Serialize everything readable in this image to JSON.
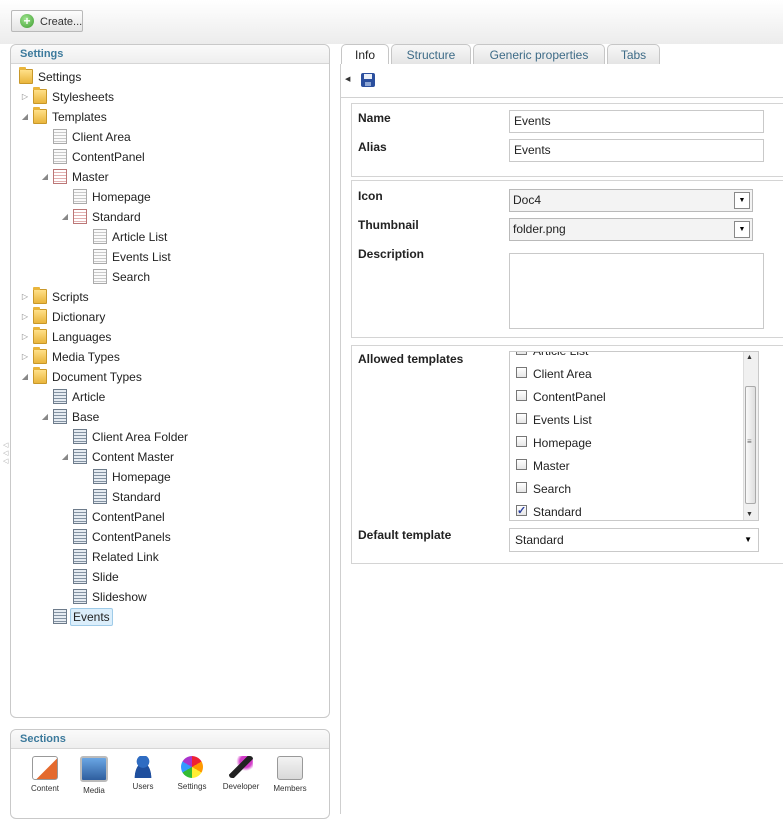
{
  "toolbar": {
    "create_label": "Create..."
  },
  "settings_panel": {
    "title": "Settings",
    "tree": [
      {
        "label": "Settings",
        "icon": "folder-icon"
      },
      {
        "label": "Stylesheets",
        "icon": "folder-icon"
      },
      {
        "label": "Templates",
        "icon": "folder-icon"
      },
      {
        "label": "Client Area",
        "icon": "template-icon"
      },
      {
        "label": "ContentPanel",
        "icon": "template-icon"
      },
      {
        "label": "Master",
        "icon": "master-template-icon"
      },
      {
        "label": "Homepage",
        "icon": "template-icon"
      },
      {
        "label": "Standard",
        "icon": "master-template-icon"
      },
      {
        "label": "Article List",
        "icon": "template-icon"
      },
      {
        "label": "Events List",
        "icon": "template-icon"
      },
      {
        "label": "Search",
        "icon": "template-icon"
      },
      {
        "label": "Scripts",
        "icon": "folder-icon"
      },
      {
        "label": "Dictionary",
        "icon": "folder-icon"
      },
      {
        "label": "Languages",
        "icon": "folder-icon"
      },
      {
        "label": "Media Types",
        "icon": "folder-icon"
      },
      {
        "label": "Document Types",
        "icon": "folder-icon"
      },
      {
        "label": "Article",
        "icon": "doctype-icon"
      },
      {
        "label": "Base",
        "icon": "doctype-icon"
      },
      {
        "label": "Client Area Folder",
        "icon": "doctype-icon"
      },
      {
        "label": "Content Master",
        "icon": "doctype-icon"
      },
      {
        "label": "Homepage",
        "icon": "doctype-icon"
      },
      {
        "label": "Standard",
        "icon": "doctype-icon"
      },
      {
        "label": "ContentPanel",
        "icon": "doctype-icon"
      },
      {
        "label": "ContentPanels",
        "icon": "doctype-icon"
      },
      {
        "label": "Related Link",
        "icon": "doctype-icon"
      },
      {
        "label": "Slide",
        "icon": "doctype-icon"
      },
      {
        "label": "Slideshow",
        "icon": "doctype-icon"
      },
      {
        "label": "Events",
        "icon": "doctype-icon",
        "selected": true
      }
    ]
  },
  "sections_panel": {
    "title": "Sections",
    "items": [
      {
        "label": "Content",
        "icon": "content-icon"
      },
      {
        "label": "Media",
        "icon": "media-icon"
      },
      {
        "label": "Users",
        "icon": "users-icon"
      },
      {
        "label": "Settings",
        "icon": "settings-icon"
      },
      {
        "label": "Developer",
        "icon": "developer-icon"
      },
      {
        "label": "Members",
        "icon": "members-icon"
      }
    ]
  },
  "tabs": [
    "Info",
    "Structure",
    "Generic properties",
    "Tabs"
  ],
  "active_tab": "Info",
  "form": {
    "name_label": "Name",
    "name_value": "Events",
    "alias_label": "Alias",
    "alias_value": "Events",
    "icon_label": "Icon",
    "icon_value": "Doc4",
    "thumbnail_label": "Thumbnail",
    "thumbnail_value": "folder.png",
    "description_label": "Description",
    "description_value": "",
    "allowed_templates_label": "Allowed templates",
    "allowed_templates": [
      {
        "label": "Article List",
        "checked": false
      },
      {
        "label": "Client Area",
        "checked": false
      },
      {
        "label": "ContentPanel",
        "checked": false
      },
      {
        "label": "Events List",
        "checked": false
      },
      {
        "label": "Homepage",
        "checked": false
      },
      {
        "label": "Master",
        "checked": false
      },
      {
        "label": "Search",
        "checked": false
      },
      {
        "label": "Standard",
        "checked": true
      }
    ],
    "default_template_label": "Default template",
    "default_template_value": "Standard"
  },
  "colors": {
    "panel_title": "#3c7a9c",
    "tab_text": "#3d6b87",
    "selection": "#dbeefb"
  }
}
